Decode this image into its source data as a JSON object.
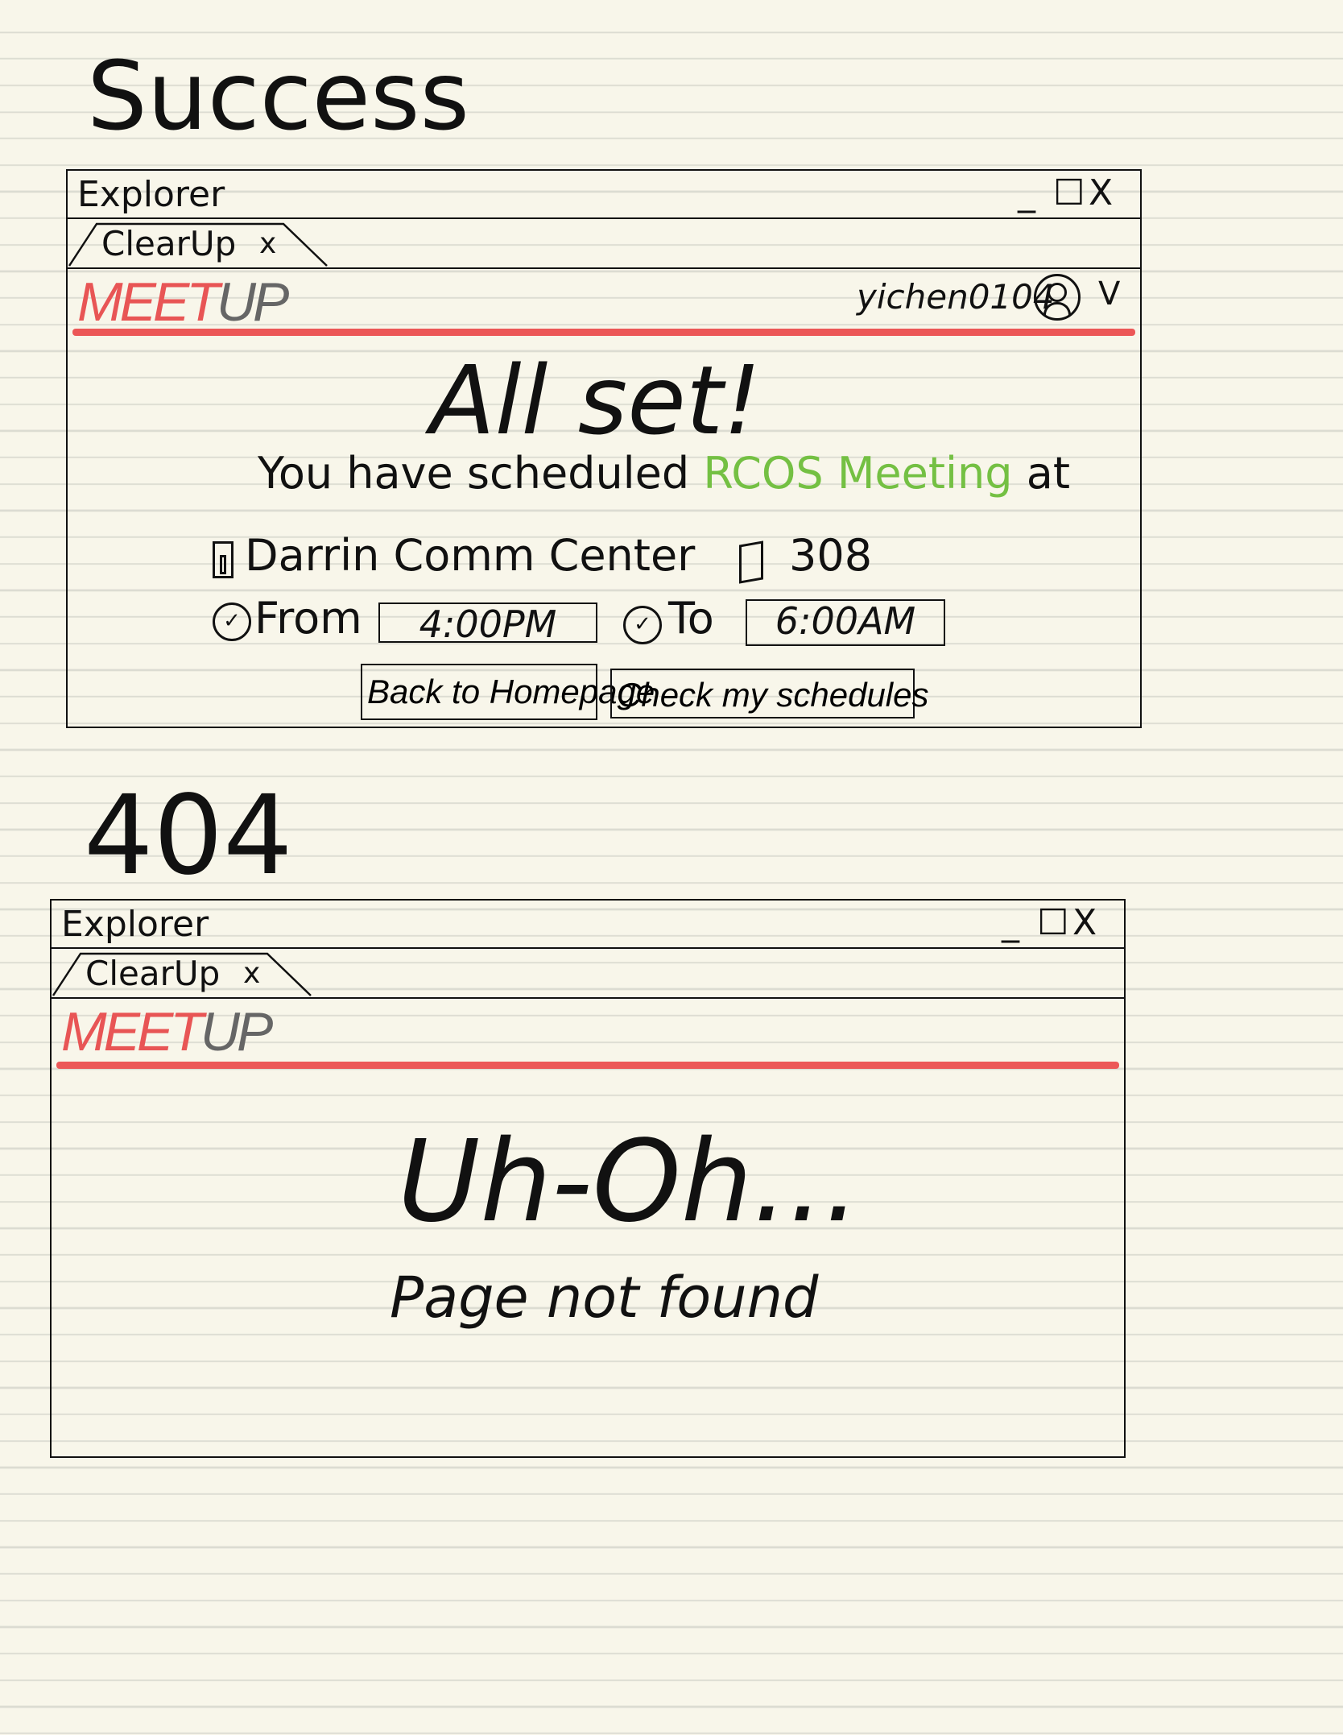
{
  "sections": {
    "success_title": "Success",
    "notfound_title": "404"
  },
  "window": {
    "title": "Explorer",
    "minimize": "_",
    "maximize": "☐",
    "close": "X",
    "tab_label": "ClearUp",
    "tab_close": "x"
  },
  "brand": {
    "meet": "MEET",
    "up": "UP",
    "meet_color": "#e85555",
    "up_color": "#666666",
    "accent": "#ec5757"
  },
  "user": {
    "name": "yichen0104",
    "menu_chevron": "V",
    "avatar_icon": "user-avatar-icon"
  },
  "success": {
    "heading": "All set!",
    "sentence_prefix": "You have scheduled",
    "meeting_name": "RCOS Meeting",
    "meeting_color": "#74c043",
    "sentence_suffix": "at",
    "location": "Darrin Comm Center",
    "room": "308",
    "from_label": "From",
    "from_value": "4:00PM",
    "to_label": "To",
    "to_value": "6:00AM",
    "back_button": "Back to Homepage",
    "schedules_button": "Check my schedules"
  },
  "notfound": {
    "heading": "Uh-Oh...",
    "message": "Page not found"
  }
}
